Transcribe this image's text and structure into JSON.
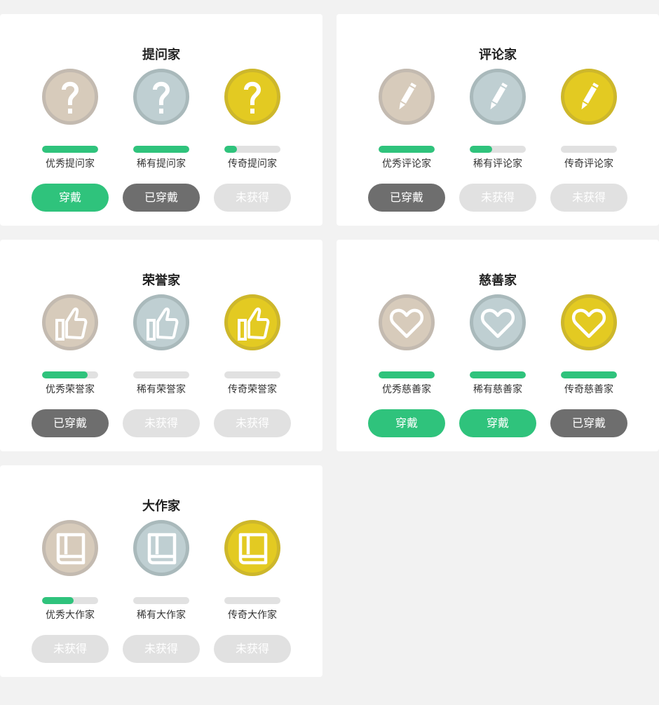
{
  "colors": {
    "background": "#f2f2f2",
    "card": "#ffffff",
    "progress_fill": "#2fc37c",
    "progress_track": "#e1e1e1",
    "wear_button": "#2fc37c",
    "worn_button": "#6e6e6e",
    "locked_button": "#e1e1e1"
  },
  "tiers": {
    "excellent": {
      "fill": "#d7cbbb",
      "ring": "#c3bab0"
    },
    "rare": {
      "fill": "#bfcfd2",
      "ring": "#a9b9bb"
    },
    "legendary": {
      "fill": "#e3ca22",
      "ring": "#cdb72b"
    }
  },
  "cards": [
    {
      "title": "提问家",
      "icon": "question-icon",
      "badges": [
        {
          "tier": "excellent",
          "label": "优秀提问家",
          "progress": 1.0,
          "button": {
            "label": "穿戴",
            "state": "wear"
          }
        },
        {
          "tier": "rare",
          "label": "稀有提问家",
          "progress": 1.0,
          "button": {
            "label": "已穿戴",
            "state": "worn"
          }
        },
        {
          "tier": "legendary",
          "label": "传奇提问家",
          "progress": 0.22,
          "button": {
            "label": "未获得",
            "state": "locked"
          }
        }
      ]
    },
    {
      "title": "评论家",
      "icon": "pencil-icon",
      "badges": [
        {
          "tier": "excellent",
          "label": "优秀评论家",
          "progress": 1.0,
          "button": {
            "label": "已穿戴",
            "state": "worn"
          }
        },
        {
          "tier": "rare",
          "label": "稀有评论家",
          "progress": 0.4,
          "button": {
            "label": "未获得",
            "state": "locked"
          }
        },
        {
          "tier": "legendary",
          "label": "传奇评论家",
          "progress": 0.0,
          "button": {
            "label": "未获得",
            "state": "locked"
          }
        }
      ]
    },
    {
      "title": "荣誉家",
      "icon": "thumbs-up-icon",
      "badges": [
        {
          "tier": "excellent",
          "label": "优秀荣誉家",
          "progress": 0.81,
          "button": {
            "label": "已穿戴",
            "state": "worn"
          }
        },
        {
          "tier": "rare",
          "label": "稀有荣誉家",
          "progress": 0.0,
          "button": {
            "label": "未获得",
            "state": "locked"
          }
        },
        {
          "tier": "legendary",
          "label": "传奇荣誉家",
          "progress": 0.0,
          "button": {
            "label": "未获得",
            "state": "locked"
          }
        }
      ]
    },
    {
      "title": "慈善家",
      "icon": "heart-icon",
      "badges": [
        {
          "tier": "excellent",
          "label": "优秀慈善家",
          "progress": 1.0,
          "button": {
            "label": "穿戴",
            "state": "wear"
          }
        },
        {
          "tier": "rare",
          "label": "稀有慈善家",
          "progress": 1.0,
          "button": {
            "label": "穿戴",
            "state": "wear"
          }
        },
        {
          "tier": "legendary",
          "label": "传奇慈善家",
          "progress": 1.0,
          "button": {
            "label": "已穿戴",
            "state": "worn"
          }
        }
      ]
    },
    {
      "title": "大作家",
      "icon": "book-icon",
      "badges": [
        {
          "tier": "excellent",
          "label": "优秀大作家",
          "progress": 0.56,
          "button": {
            "label": "未获得",
            "state": "locked"
          }
        },
        {
          "tier": "rare",
          "label": "稀有大作家",
          "progress": 0.0,
          "button": {
            "label": "未获得",
            "state": "locked"
          }
        },
        {
          "tier": "legendary",
          "label": "传奇大作家",
          "progress": 0.0,
          "button": {
            "label": "未获得",
            "state": "locked"
          }
        }
      ]
    }
  ]
}
